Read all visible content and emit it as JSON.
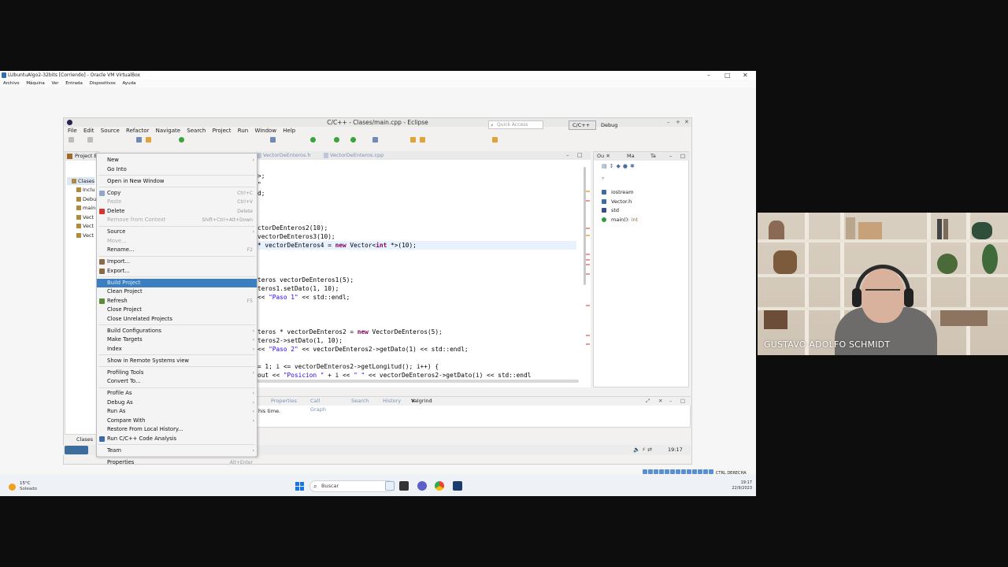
{
  "vbox": {
    "title": "LUbuntuAlgo2-32bits [Corriendo] - Oracle VM VirtualBox",
    "menu": [
      "Archivo",
      "Máquina",
      "Ver",
      "Entrada",
      "Dispositivos",
      "Ayuda"
    ]
  },
  "eclipse": {
    "title": "C/C++ - Clases/main.cpp - Eclipse",
    "menu": [
      "File",
      "Edit",
      "Source",
      "Refactor",
      "Navigate",
      "Search",
      "Project",
      "Run",
      "Window",
      "Help"
    ],
    "quick_access_placeholder": "Quick Access",
    "perspective_cc": "C/C++",
    "perspective_debug": "Debug"
  },
  "project_explorer": {
    "tab": "Project E",
    "items": [
      "Clases",
      "Inclu",
      "Debu",
      "main",
      "Vect",
      "Vect",
      "Vect"
    ],
    "bottom_label": "Clases"
  },
  "editor": {
    "tabs": [
      "VectorDeEnteros.h",
      "VectorDeEnteros.cpp"
    ],
    "lines": [
      {
        "segments": [
          {
            "t": ">;",
            "c": ""
          }
        ]
      },
      {
        "segments": [
          {
            "t": "\"",
            "c": ""
          }
        ]
      },
      {
        "segments": [
          {
            "t": "d;",
            "c": ""
          }
        ]
      },
      {
        "segments": [
          {
            "t": "",
            "c": ""
          }
        ]
      },
      {
        "segments": [
          {
            "t": "",
            "c": ""
          }
        ]
      },
      {
        "segments": [
          {
            "t": "ctorDeEnteros2(10);",
            "c": ""
          }
        ]
      },
      {
        "segments": [
          {
            "t": "vectorDeEnteros3(10);",
            "c": ""
          }
        ]
      },
      {
        "segments": [
          {
            "t": "* vectorDeEnteros4 = ",
            "c": ""
          },
          {
            "t": "new",
            "c": "kw"
          },
          {
            "t": " Vector<",
            "c": ""
          },
          {
            "t": "int",
            "c": "kw"
          },
          {
            "t": " *>(10);",
            "c": ""
          }
        ]
      },
      {
        "segments": [
          {
            "t": "",
            "c": ""
          }
        ]
      },
      {
        "segments": [
          {
            "t": "",
            "c": ""
          }
        ]
      },
      {
        "segments": [
          {
            "t": "",
            "c": ""
          }
        ]
      },
      {
        "segments": [
          {
            "t": "teros vectorDeEnteros1(5);",
            "c": ""
          }
        ]
      },
      {
        "segments": [
          {
            "t": "teros1.setDato(1, 10);",
            "c": ""
          }
        ]
      },
      {
        "segments": [
          {
            "t": "<< ",
            "c": ""
          },
          {
            "t": "\"Paso 1\"",
            "c": "str"
          },
          {
            "t": " << std::endl;",
            "c": ""
          }
        ]
      },
      {
        "segments": [
          {
            "t": "",
            "c": ""
          }
        ]
      },
      {
        "segments": [
          {
            "t": "",
            "c": ""
          }
        ]
      },
      {
        "segments": [
          {
            "t": "",
            "c": ""
          }
        ]
      },
      {
        "segments": [
          {
            "t": "teros * vectorDeEnteros2 = ",
            "c": ""
          },
          {
            "t": "new",
            "c": "kw"
          },
          {
            "t": " VectorDeEnteros(5);",
            "c": ""
          }
        ]
      },
      {
        "segments": [
          {
            "t": "teros2->setDato(1, 10);",
            "c": ""
          }
        ]
      },
      {
        "segments": [
          {
            "t": "<< ",
            "c": ""
          },
          {
            "t": "\"Paso 2\"",
            "c": "str"
          },
          {
            "t": " << vectorDeEnteros2->getDato(1) << std::endl;",
            "c": ""
          }
        ]
      },
      {
        "segments": [
          {
            "t": "",
            "c": ""
          }
        ]
      },
      {
        "segments": [
          {
            "t": "= 1; i <= vectorDeEnteros2->getLongitud(); i++) {",
            "c": ""
          }
        ]
      },
      {
        "segments": [
          {
            "t": "out << ",
            "c": ""
          },
          {
            "t": "\"Posicion \"",
            "c": "str"
          },
          {
            "t": " + i << ",
            "c": ""
          },
          {
            "t": "\" \"",
            "c": "str"
          },
          {
            "t": " << vectorDeEnteros2->getDato(i) << std::endl",
            "c": ""
          }
        ]
      }
    ]
  },
  "outline": {
    "tabs": [
      "Ou",
      "Ma",
      "Ta"
    ],
    "items": [
      {
        "label": "iostream",
        "ret": ""
      },
      {
        "label": "Vector.h",
        "ret": ""
      },
      {
        "label": "std",
        "ret": ""
      },
      {
        "label": "main()",
        "ret": ": int"
      }
    ]
  },
  "bottom_panel": {
    "tabs": [
      "Properties",
      "Call Graph",
      "Search",
      "History",
      "Valgrind"
    ],
    "message": "his time."
  },
  "context_menu": {
    "items": [
      {
        "label": "New",
        "shortcut": "",
        "arrow": true,
        "disabled": false
      },
      {
        "label": "Go Into",
        "shortcut": "",
        "arrow": false,
        "disabled": false
      },
      {
        "label": "Open in New Window",
        "shortcut": "",
        "arrow": false,
        "disabled": false
      },
      {
        "label": "Copy",
        "shortcut": "Ctrl+C",
        "arrow": false,
        "disabled": false
      },
      {
        "label": "Paste",
        "shortcut": "Ctrl+V",
        "arrow": false,
        "disabled": true
      },
      {
        "label": "Delete",
        "shortcut": "Delete",
        "arrow": false,
        "disabled": false
      },
      {
        "label": "Remove from Context",
        "shortcut": "Shift+Ctrl+Alt+Down",
        "arrow": false,
        "disabled": true
      },
      {
        "label": "Source",
        "shortcut": "",
        "arrow": true,
        "disabled": false
      },
      {
        "label": "Move...",
        "shortcut": "",
        "arrow": false,
        "disabled": true
      },
      {
        "label": "Rename...",
        "shortcut": "F2",
        "arrow": false,
        "disabled": false
      },
      {
        "label": "Import...",
        "shortcut": "",
        "arrow": false,
        "disabled": false
      },
      {
        "label": "Export...",
        "shortcut": "",
        "arrow": false,
        "disabled": false
      },
      {
        "label": "Build Project",
        "shortcut": "",
        "arrow": false,
        "disabled": false
      },
      {
        "label": "Clean Project",
        "shortcut": "",
        "arrow": false,
        "disabled": false
      },
      {
        "label": "Refresh",
        "shortcut": "F5",
        "arrow": false,
        "disabled": false
      },
      {
        "label": "Close Project",
        "shortcut": "",
        "arrow": false,
        "disabled": false
      },
      {
        "label": "Close Unrelated Projects",
        "shortcut": "",
        "arrow": false,
        "disabled": false
      },
      {
        "label": "Build Configurations",
        "shortcut": "",
        "arrow": true,
        "disabled": false
      },
      {
        "label": "Make Targets",
        "shortcut": "",
        "arrow": true,
        "disabled": false
      },
      {
        "label": "Index",
        "shortcut": "",
        "arrow": true,
        "disabled": false
      },
      {
        "label": "Show in Remote Systems view",
        "shortcut": "",
        "arrow": false,
        "disabled": false
      },
      {
        "label": "Profiling Tools",
        "shortcut": "",
        "arrow": true,
        "disabled": false
      },
      {
        "label": "Convert To...",
        "shortcut": "",
        "arrow": false,
        "disabled": false
      },
      {
        "label": "Profile As",
        "shortcut": "",
        "arrow": true,
        "disabled": false
      },
      {
        "label": "Debug As",
        "shortcut": "",
        "arrow": true,
        "disabled": false
      },
      {
        "label": "Run As",
        "shortcut": "",
        "arrow": true,
        "disabled": false
      },
      {
        "label": "Compare With",
        "shortcut": "",
        "arrow": true,
        "disabled": false
      },
      {
        "label": "Restore From Local History...",
        "shortcut": "",
        "arrow": false,
        "disabled": false
      },
      {
        "label": "Run C/C++ Code Analysis",
        "shortcut": "",
        "arrow": false,
        "disabled": false
      },
      {
        "label": "Team",
        "shortcut": "",
        "arrow": true,
        "disabled": false
      },
      {
        "label": "Properties",
        "shortcut": "Alt+Enter",
        "arrow": false,
        "disabled": false
      }
    ],
    "selected_index": 12
  },
  "vm_status": {
    "clock": "19:17"
  },
  "taskbar": {
    "weather_temp": "15°C",
    "weather_desc": "Soleado",
    "search_placeholder": "Buscar",
    "time": "19:17",
    "date": "22/9/2023",
    "host_key": "CTRL DERECHA"
  },
  "webcam": {
    "name": "GUSTAVO ADOLFO SCHMIDT"
  },
  "colors": {
    "selection": "#3c7fc0",
    "keyword": "#7f0055",
    "string": "#2a00ff"
  }
}
